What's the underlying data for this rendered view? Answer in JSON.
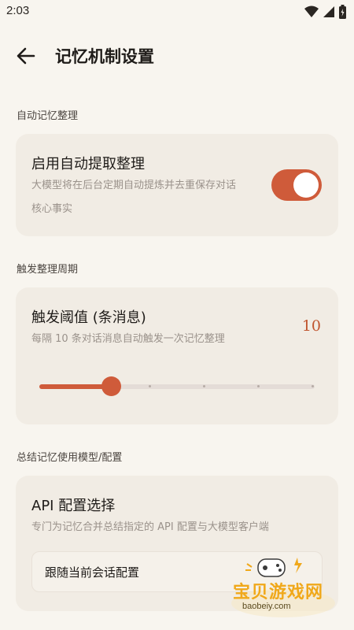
{
  "status_bar": {
    "time": "2:03",
    "icons": [
      "wifi-icon",
      "signal-icon",
      "battery-icon"
    ]
  },
  "header": {
    "title": "记忆机制设置",
    "back_icon": "arrow-left-icon"
  },
  "sections": {
    "auto": {
      "label": "自动记忆整理",
      "card_title": "启用自动提取整理",
      "description_line1": "大模型将在后台定期自动提炼并去重保存对话",
      "description_line2": "核心事实",
      "toggle_on": true
    },
    "trigger": {
      "label": "触发整理周期",
      "card_title": "触发阈值 (条消息)",
      "description": "每隔 10 条对话消息自动触发一次记忆整理",
      "value": "10",
      "slider_fraction": 0.2
    },
    "model": {
      "label": "总结记忆使用模型/配置",
      "card_title": "API 配置选择",
      "description": "专门为记忆合并总结指定的 API 配置与大模型客户端",
      "selected": "跟随当前会话配置"
    }
  },
  "watermark": {
    "text": "宝贝游戏网",
    "url": "baobeiy.com"
  },
  "colors": {
    "accent": "#cf5b3a",
    "background": "#f8f5ef",
    "card": "#f1ece4"
  }
}
